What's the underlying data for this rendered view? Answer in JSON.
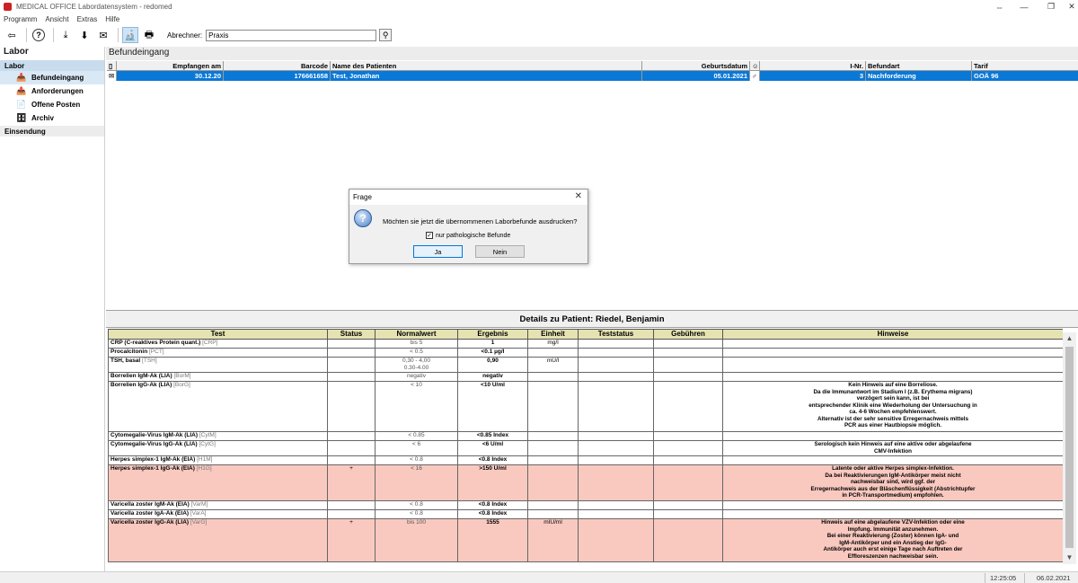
{
  "window": {
    "title": "MEDICAL OFFICE Labordatensystem - redomed"
  },
  "menu": [
    "Programm",
    "Ansicht",
    "Extras",
    "Hilfe"
  ],
  "toolbar": {
    "abrechner_label": "Abrechner:",
    "abrechner_value": "Praxis"
  },
  "sidebar": {
    "header": "Labor",
    "group_labor": "Labor",
    "items": [
      {
        "label": "Befundeingang",
        "icon": "inbox-icon"
      },
      {
        "label": "Anforderungen",
        "icon": "request-icon"
      },
      {
        "label": "Offene Posten",
        "icon": "open-items-icon"
      },
      {
        "label": "Archiv",
        "icon": "archive-icon"
      }
    ],
    "group_einsendung": "Einsendung"
  },
  "main": {
    "title": "Befundeingang",
    "grid_headers": [
      "Empfangen am",
      "Barcode",
      "Name des Patienten",
      "Geburtsdatum",
      "I-Nr.",
      "Befundart",
      "Tarif"
    ],
    "rows": [
      {
        "empfangen": "30.12.20",
        "barcode": "176661658",
        "name": "Test, Jonathan",
        "geburtsdatum": "05.01.2021",
        "gender": "♂",
        "inr": "3",
        "befundart": "Nachforderung",
        "tarif": "GOÄ 96"
      }
    ]
  },
  "dialog": {
    "title": "Frage",
    "message": "Möchten sie jetzt die übernommenen Laborbefunde ausdrucken?",
    "checkbox_label": "nur pathologische Befunde",
    "checkbox_checked": true,
    "yes": "Ja",
    "no": "Nein"
  },
  "details": {
    "title": "Details zu Patient: Riedel,  Benjamin",
    "headers": [
      "Test",
      "Status",
      "Normalwert",
      "Ergebnis",
      "Einheit",
      "Teststatus",
      "Gebühren",
      "Hinweise"
    ],
    "rows": [
      {
        "test": "CRP (C-reaktives Protein quant.)",
        "code": "[CRP]",
        "status": "",
        "norm": "bis 5",
        "res": "1",
        "unit": "mg/l",
        "hint": "",
        "path": false
      },
      {
        "test": "Procalcitonin",
        "code": "[PCT]",
        "status": "",
        "norm": "< 0.5",
        "res": "<0.1 µg/l",
        "unit": "",
        "hint": "",
        "path": false
      },
      {
        "test": "TSH, basal",
        "code": "[TSH]",
        "status": "",
        "norm": "0,30 - 4,00\n0.30-4.00",
        "res": "0,90",
        "unit": "mU/l",
        "hint": "",
        "path": false
      },
      {
        "test": "Borrelien IgM-Ak (LIA)",
        "code": "[BorM]",
        "status": "",
        "norm": "negativ",
        "res": "negativ",
        "unit": "",
        "hint": "",
        "path": false
      },
      {
        "test": "Borrelien IgG-Ak (LIA)",
        "code": "[BorG]",
        "status": "",
        "norm": "< 10",
        "res": "<10 U/ml",
        "unit": "",
        "hint": "Kein Hinweis auf eine Borreliose.\nDa die Immunantwort im Stadium I (z.B. Erythema migrans)\nverzögert sein kann, ist bei\nentsprechender Klinik eine Wiederholung der Untersuchung in\nca. 4-6 Wochen empfehlenswert.\nAlternativ ist der sehr sensitive Erregernachweis mittels\nPCR aus einer Hautbiopsie möglich.",
        "path": false
      },
      {
        "test": "Cytomegalie-Virus IgM-Ak (LIA)",
        "code": "[CytM]",
        "status": "",
        "norm": "< 0.85",
        "res": "<0.85 Index",
        "unit": "",
        "hint": "",
        "path": false
      },
      {
        "test": "Cytomegalie-Virus IgG-Ak (LIA)",
        "code": "[CytG]",
        "status": "",
        "norm": "< 6",
        "res": "<6 U/ml",
        "unit": "",
        "hint": "Serologisch kein Hinweis auf eine aktive oder abgelaufene\nCMV-Infektion",
        "path": false
      },
      {
        "test": "Herpes simplex-1 IgM-Ak (EIA)",
        "code": "[H1M]",
        "status": "",
        "norm": "< 0.8",
        "res": "<0.8 Index",
        "unit": "",
        "hint": "",
        "path": false
      },
      {
        "test": "Herpes simplex-1 IgG-Ak (EIA)",
        "code": "[H1G]",
        "status": "+",
        "norm": "< 16",
        "res": ">150 U/ml",
        "unit": "",
        "hint": "Latente oder aktive Herpes simplex-Infektion.\nDa bei Reaktivierungen IgM-Antikörper meist nicht\nnachweisbar sind, wird ggf. der\nErregernachweis aus der Bläschenflüssigkeit (Abstrichtupfer\nin PCR-Transportmedium) empfohlen.",
        "path": true
      },
      {
        "test": "Varicella zoster IgM-Ak (EIA)",
        "code": "[VarM]",
        "status": "",
        "norm": "< 0.8",
        "res": "<0.8 Index",
        "unit": "",
        "hint": "",
        "path": false
      },
      {
        "test": "Varicella zoster IgA-Ak (EIA)",
        "code": "[VarA]",
        "status": "",
        "norm": "< 0.8",
        "res": "<0.8 Index",
        "unit": "",
        "hint": "",
        "path": false
      },
      {
        "test": "Varicella zoster IgG-Ak (LIA)",
        "code": "[VarG]",
        "status": "+",
        "norm": "bis 100",
        "res": "1555",
        "unit": "mIU/ml",
        "hint": "Hinweis auf eine abgelaufene VZV-Infektion oder eine\nImpfung. Immunität anzunehmen.\nBei einer Reaktivierung (Zoster) können IgA- und\nIgM-Antikörper und ein Anstieg der IgG-\nAntikörper auch erst einige Tage nach Auftreten der\nEffloreszenzen nachweisbar sein.",
        "path": true
      }
    ]
  },
  "status": {
    "time": "12:25:05",
    "date": "06.02.2021"
  }
}
